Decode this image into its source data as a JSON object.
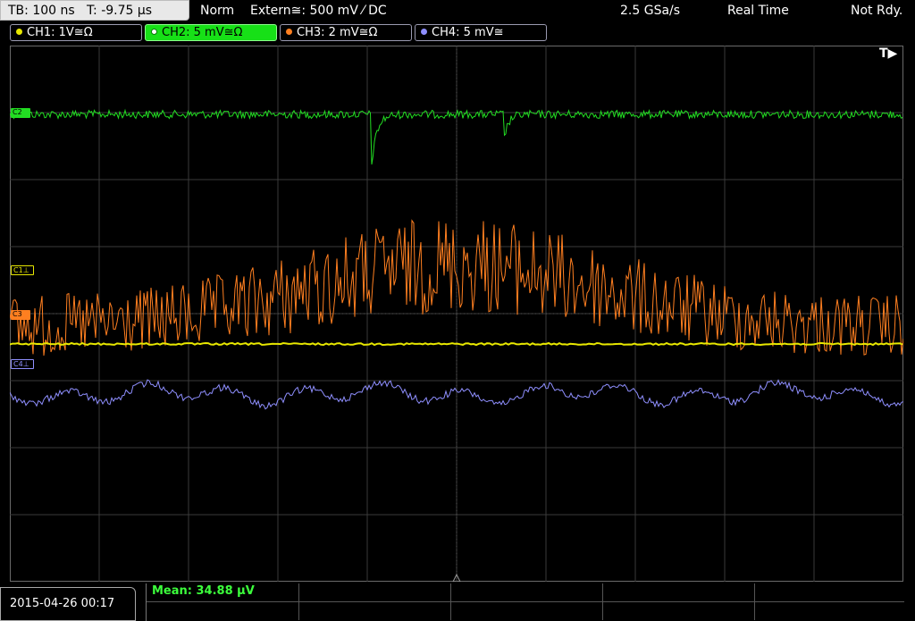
{
  "top_bar": {
    "timebase": "TB: 100 ns",
    "trigger_time": "T: -9.75 µs",
    "acq_mode": "Norm",
    "trigger": "Extern≅: 500 mV ⁄ DC",
    "sample_rate": "2.5 GSa/s",
    "realtime": "Real Time",
    "state": "Not Rdy."
  },
  "channels": [
    {
      "label": "CH1: 1V≅Ω",
      "color": "#e8e800"
    },
    {
      "label": "CH2: 5 mV≅Ω",
      "color": "#22dd22"
    },
    {
      "label": "CH3: 2 mV≅Ω",
      "color": "#ff7f20"
    },
    {
      "label": "CH4: 5 mV≅",
      "color": "#8f8fff"
    }
  ],
  "markers": {
    "ch1": "C1",
    "ch2": "C2",
    "ch3": "C3",
    "ch4": "C4",
    "trigger_flag": "T▶"
  },
  "footer": {
    "datetime": "2015-04-26 00:17",
    "measurement": "Mean: 34.88 µV"
  }
}
